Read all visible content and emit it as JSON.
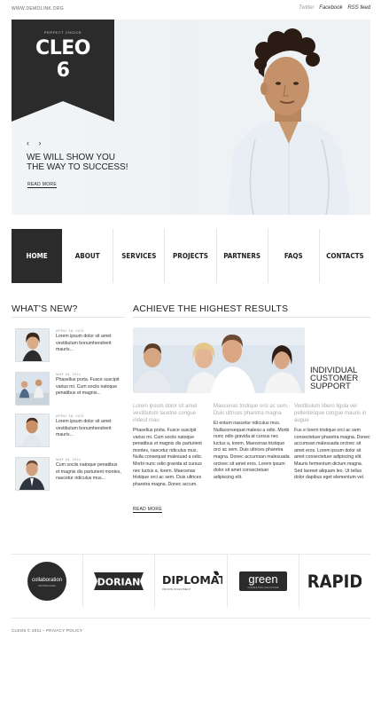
{
  "topbar": {
    "site": "WWW.DEMOLINK.ORG",
    "links": [
      "Twitter",
      "Facebook",
      "RSS feed"
    ]
  },
  "hero": {
    "tagline": "PERFECT CHOICE",
    "logo_line1": "CLEO",
    "logo_line2": "6",
    "prev": "‹",
    "next": "›",
    "slogan_line1": "WE WILL SHOW YOU",
    "slogan_line2": "THE WAY TO SUCCESS!",
    "read_more": "READ MORE"
  },
  "nav": {
    "items": [
      "HOME",
      "ABOUT",
      "SERVICES",
      "PROJECTS",
      "PARTNERS",
      "FAQS",
      "CONTACTS"
    ]
  },
  "news": {
    "title": "WHAT'S NEW?",
    "items": [
      {
        "date": "APRIL 18, 2011",
        "text": "Lorem ipsum dolor sit amet vestibulum bonumhendrerit mauris..."
      },
      {
        "date": "MAY 18, 2011",
        "text": "Phasellus porta. Fusce suscipit varius mi. Cum sociis natoque penatibus et magnis..."
      },
      {
        "date": "APRIL 18, 2011",
        "text": "Lorem ipsum dolor sit amet vestibulum bonumhendrerit mauris..."
      },
      {
        "date": "MAY 18, 2011",
        "text": "Cum sociis natoque penatibus et magnis dis parturient montes, nascetur ridiculus mus..."
      }
    ]
  },
  "achieve": {
    "title": "ACHIEVE THE HIGHEST RESULTS",
    "support_line1": "INDIVIDUAL",
    "support_line2": "CUSTOMER",
    "support_line3": "SUPPORT",
    "columns": [
      {
        "lead": "Lorem ipsum dolor sit amet vestibulum lacetne congue indeut mau",
        "body": "Phasellus porta. Fusce suscipit varius mi. Cum sociis natoque penatibus et magnis dis parturient montes, nascetur ridiculus mus. Nulla consequat malesuad a odio. Morbi nunc odio gravida at cursus nec luctus a, lorem. Maecenas tristique orci ac sem. Duis ultrices pharetra magna. Donec accum."
      },
      {
        "lead": "Maecenas tristique orci ac sem. Duis ultrices pharetra magna",
        "body": "Et entum nascetur ridiculus mus. Nullaconsequat malesu a odio. Morbi nunc odio gravida at cursus nec luctus a, lorem. Maecenas tristique orci ac sem. Duis ultrices pharetra magna. Donec accumsan malesuada orcinec sit amet eros. Lorem ipsum dolor sit amet consectetuer adipiscing elit."
      },
      {
        "lead": "Vestibulum libero ligula vel pellentesque congue mauris in augue",
        "body": "Fus e lorem tristique orci ac sem consectetuer pharetra magna. Donec accumsan malesuada orcinec sit amet eros. Lorem ipsum dolor sit amet consectetuer adipiscing elit. Mauris fermentum dictum magna. Sed laoreet aliquam leo. Ut tellus dolor dapibus eget elementum vel."
      }
    ],
    "read_more": "READ MORE"
  },
  "partners": [
    {
      "name": "collaboration",
      "sub": "TECHNOLOGIES"
    },
    {
      "name": "DORIAN",
      "sub": ""
    },
    {
      "name": "DIPLOMAT",
      "sub": "PRIVATE INVESTMENT"
    },
    {
      "name": "green",
      "sub": "CONSULTING SOLUTIONS"
    },
    {
      "name": "RAPID",
      "sub": ""
    }
  ],
  "footer": {
    "copyright": "CLEO6 © 2011",
    "separator": "•",
    "privacy": "PRIVACY POLICY"
  }
}
